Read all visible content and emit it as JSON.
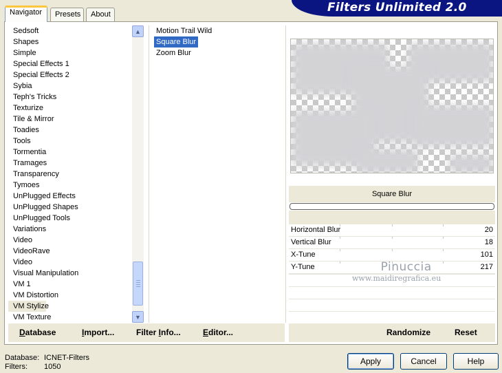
{
  "tabs": [
    "Navigator",
    "Presets",
    "About"
  ],
  "app_title": "Filters Unlimited 2.0",
  "categories": [
    "Sedsoft",
    "Shapes",
    "Simple",
    "Special Effects 1",
    "Special Effects 2",
    "Sybia",
    "Teph's Tricks",
    "Texturize",
    "Tile & Mirror",
    "Toadies",
    "Tools",
    "Tormentia",
    "Tramages",
    "Transparency",
    "Tymoes",
    "UnPlugged Effects",
    "UnPlugged Shapes",
    "UnPlugged Tools",
    "Variations",
    "Video",
    "VideoRave",
    "Video",
    "Visual Manipulation",
    "VM 1",
    "VM Distortion",
    "VM Stylize",
    "VM Texture"
  ],
  "selected_category": "VM Stylize",
  "filters": [
    "Motion Trail Wild",
    "Square Blur",
    "Zoom Blur"
  ],
  "selected_filter": "Square Blur",
  "current_filter_title": "Square Blur",
  "params": [
    {
      "name": "Horizontal Blur",
      "value": "20"
    },
    {
      "name": "Vertical Blur",
      "value": "18"
    },
    {
      "name": "X-Tune",
      "value": "101"
    },
    {
      "name": "Y-Tune",
      "value": "217"
    }
  ],
  "watermark": {
    "line1": "Pinuccia",
    "line2": "www.maidiregrafica.eu"
  },
  "toolbar": {
    "database": {
      "u": "D",
      "rest": "atabase"
    },
    "import": {
      "u": "I",
      "rest": "mport..."
    },
    "filter_info": {
      "pre": "Filter ",
      "u": "I",
      "rest": "nfo..."
    },
    "editor": {
      "u": "E",
      "rest": "ditor..."
    },
    "randomize": "Randomize",
    "reset": "Reset"
  },
  "footer": {
    "database_label": "Database:",
    "database_value": "ICNET-Filters",
    "filters_label": "Filters:",
    "filters_value": "1050"
  },
  "buttons": {
    "apply": "Apply",
    "cancel": "Cancel",
    "help": "Help"
  }
}
